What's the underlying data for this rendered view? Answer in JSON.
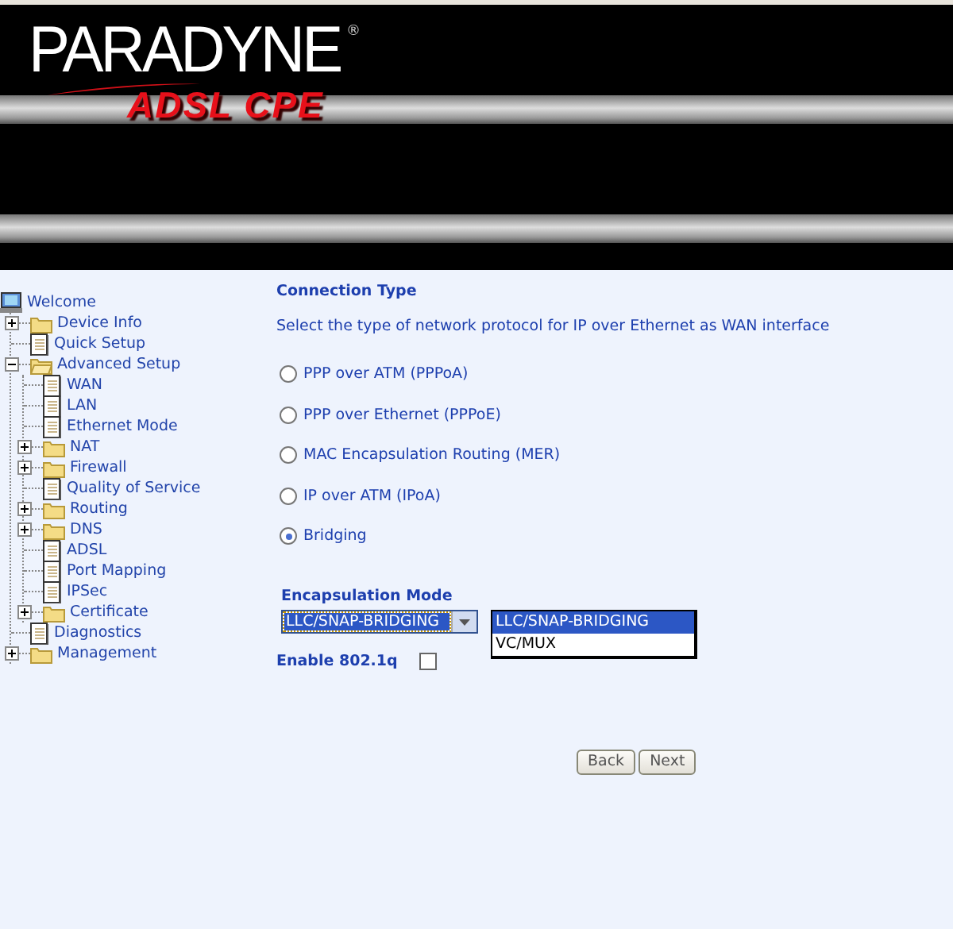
{
  "header": {
    "brand": "PARADYNE",
    "registered": "®",
    "product": "ADSL CPE"
  },
  "tree": {
    "label": "Welcome",
    "kind": "computer",
    "children": [
      {
        "label": "Device Info",
        "kind": "folder",
        "expanded": false
      },
      {
        "label": "Quick Setup",
        "kind": "page"
      },
      {
        "label": "Advanced Setup",
        "kind": "folder",
        "expanded": true,
        "children": [
          {
            "label": "WAN",
            "kind": "page"
          },
          {
            "label": "LAN",
            "kind": "page"
          },
          {
            "label": "Ethernet Mode",
            "kind": "page"
          },
          {
            "label": "NAT",
            "kind": "folder",
            "expanded": false
          },
          {
            "label": "Firewall",
            "kind": "folder",
            "expanded": false
          },
          {
            "label": "Quality of Service",
            "kind": "page"
          },
          {
            "label": "Routing",
            "kind": "folder",
            "expanded": false
          },
          {
            "label": "DNS",
            "kind": "folder",
            "expanded": false
          },
          {
            "label": "ADSL",
            "kind": "page"
          },
          {
            "label": "Port Mapping",
            "kind": "page"
          },
          {
            "label": "IPSec",
            "kind": "page"
          },
          {
            "label": "Certificate",
            "kind": "folder",
            "expanded": false
          }
        ]
      },
      {
        "label": "Diagnostics",
        "kind": "page"
      },
      {
        "label": "Management",
        "kind": "folder",
        "expanded": false
      }
    ]
  },
  "content": {
    "title": "Connection Type",
    "description": "Select the type of network protocol for IP over Ethernet as WAN interface",
    "connection_types": [
      {
        "label": "PPP over ATM (PPPoA)",
        "selected": false
      },
      {
        "label": "PPP over Ethernet (PPPoE)",
        "selected": false
      },
      {
        "label": "MAC Encapsulation Routing (MER)",
        "selected": false
      },
      {
        "label": "IP over ATM (IPoA)",
        "selected": false
      },
      {
        "label": "Bridging",
        "selected": true
      }
    ],
    "encapsulation": {
      "label": "Encapsulation Mode",
      "value": "LLC/SNAP-BRIDGING",
      "expanded": true,
      "options": [
        {
          "label": "LLC/SNAP-BRIDGING",
          "selected": true
        },
        {
          "label": "VC/MUX",
          "selected": false
        }
      ]
    },
    "vlan": {
      "label": "Enable 802.1q",
      "checked": false
    },
    "buttons": [
      {
        "label": "Back"
      },
      {
        "label": "Next"
      }
    ]
  }
}
